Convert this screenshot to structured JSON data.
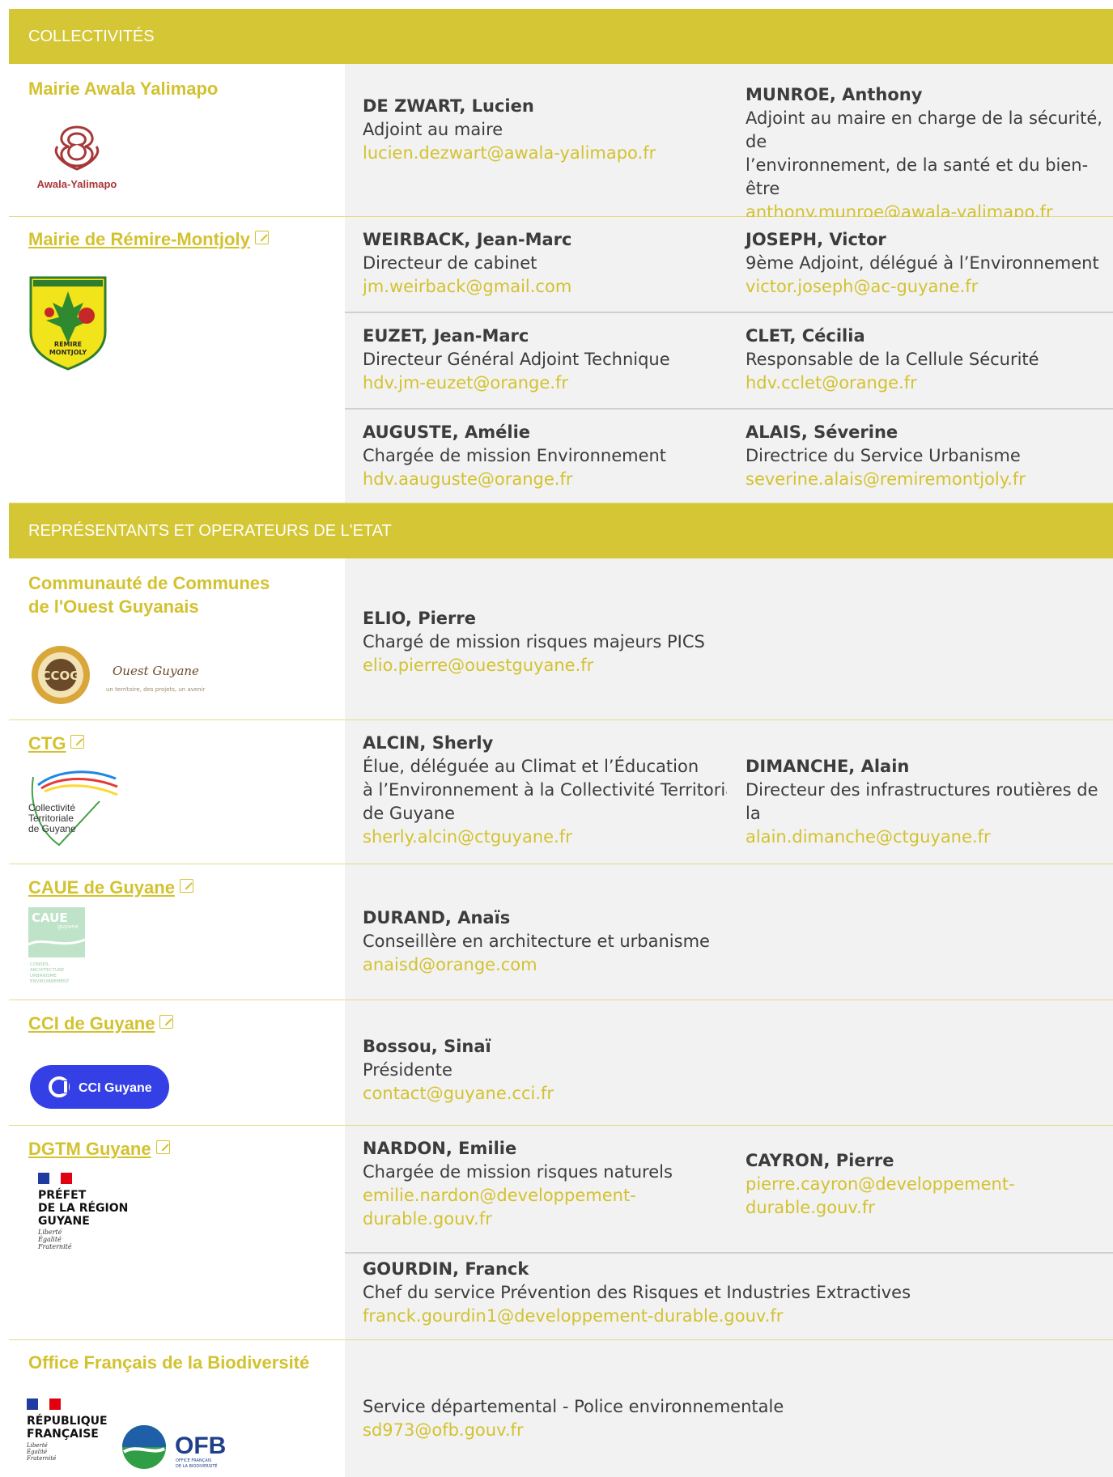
{
  "sections": {
    "collectivites": "COLLECTIVITÉS",
    "etat": "REPRÉSENTANTS ET OPERATEURS DE L'ETAT"
  },
  "accent_color": "#d4c635",
  "orgs": {
    "awala": {
      "name": "Mairie Awala Yalimapo",
      "logo_text": "Awala-Yalimapo",
      "contacts": [
        {
          "name": "DE ZWART, Lucien",
          "role": "Adjoint au maire",
          "email": "lucien.dezwart@awala-yalimapo.fr"
        },
        {
          "name": "MUNROE, Anthony",
          "role": "Adjoint au maire en charge de la sécurité, de\nl’environnement, de la santé et du bien-être",
          "email": "anthony.munroe@awala-yalimapo.fr"
        }
      ]
    },
    "remire": {
      "name": "Mairie de Rémire-Montjoly",
      "logo_text": "REMIRE MONTJOLY",
      "contacts": [
        {
          "name": "WEIRBACK, Jean-Marc",
          "role": "Directeur de cabinet",
          "email": "jm.weirback@gmail.com"
        },
        {
          "name": "JOSEPH, Victor",
          "role": "9ème Adjoint, délégué à l’Environnement",
          "email": "victor.joseph@ac-guyane.fr"
        },
        {
          "name": "EUZET, Jean-Marc",
          "role": "Directeur Général Adjoint Technique",
          "email": "hdv.jm-euzet@orange.fr"
        },
        {
          "name": "CLET, Cécilia",
          "role": "Responsable de la Cellule Sécurité",
          "email": "hdv.cclet@orange.fr"
        },
        {
          "name": "AUGUSTE, Amélie",
          "role": "Chargée de mission Environnement",
          "email": "hdv.aauguste@orange.fr"
        },
        {
          "name": "ALAIS, Séverine",
          "role": "Directrice du Service Urbanisme",
          "email": "severine.alais@remiremontjoly.fr"
        }
      ]
    },
    "ccog": {
      "name": "Communauté de Communes\nde l'Ouest Guyanais",
      "logo_text": "CCOG",
      "logo_script": "Ouest Guyane",
      "logo_tagline": "un territoire, des projets, un avenir",
      "contacts": [
        {
          "name": "ELIO, Pierre",
          "role": "Chargé de mission risques majeurs PICS",
          "email": "elio.pierre@ouestguyane.fr"
        }
      ]
    },
    "ctg": {
      "name": "CTG",
      "logo_lines": [
        "Collectivité",
        "Territoriale",
        "de Guyane"
      ],
      "contacts": [
        {
          "name": "ALCIN, Sherly",
          "role": "Élue, déléguée au Climat et l’Éducation\nà l’Environnement à la Collectivité Territorial\nde Guyane",
          "email": "sherly.alcin@ctguyane.fr"
        },
        {
          "name": "DIMANCHE, Alain",
          "role": "Directeur des infrastructures routières de la",
          "email": "alain.dimanche@ctguyane.fr"
        }
      ]
    },
    "caue": {
      "name": "CAUE de Guyane",
      "logo_text": "CAUE",
      "logo_sub": "guyane",
      "logo_lines": [
        "CONSEIL",
        "ARCHITECTURE",
        "URBANISME",
        "ENVIRONNEMENT"
      ],
      "contacts": [
        {
          "name": "DURAND, Anaïs",
          "role": "Conseillère en architecture et urbanisme",
          "email": "anaisd@orange.com"
        }
      ]
    },
    "cci": {
      "name": "CCI de Guyane",
      "logo_text": "CCI Guyane",
      "contacts": [
        {
          "name": "Bossou, Sinaï",
          "role": "Présidente",
          "email": "contact@guyane.cci.fr"
        }
      ]
    },
    "dgtm": {
      "name": "DGTM Guyane",
      "logo_lines": [
        "PRÉFET",
        "DE LA RÉGION",
        "GUYANE"
      ],
      "logo_motto": [
        "Liberté",
        "Égalité",
        "Fraternité"
      ],
      "contacts": [
        {
          "name": "NARDON, Emilie",
          "role": "Chargée de mission risques naturels",
          "email": "emilie.nardon@developpement-\ndurable.gouv.fr"
        },
        {
          "name": "CAYRON, Pierre",
          "role": "",
          "email": "pierre.cayron@developpement-\ndurable.gouv.fr"
        },
        {
          "name": "GOURDIN, Franck",
          "role": "Chef du service Prévention des Risques et Industries Extractives",
          "email": "franck.gourdin1@developpement-durable.gouv.fr"
        }
      ]
    },
    "ofb": {
      "name": "Office Français de la Biodiversité",
      "logo_lines": [
        "RÉPUBLIQUE",
        "FRANÇAISE"
      ],
      "logo_motto": [
        "Liberté",
        "Égalité",
        "Fraternité"
      ],
      "logo_text": "OFB",
      "logo_sub": [
        "OFFICE FRANÇAIS",
        "DE LA BIODIVERSITÉ"
      ],
      "contacts": [
        {
          "name": "",
          "role": "Service départemental - Police environnementale",
          "email": "sd973@ofb.gouv.fr"
        }
      ]
    }
  }
}
